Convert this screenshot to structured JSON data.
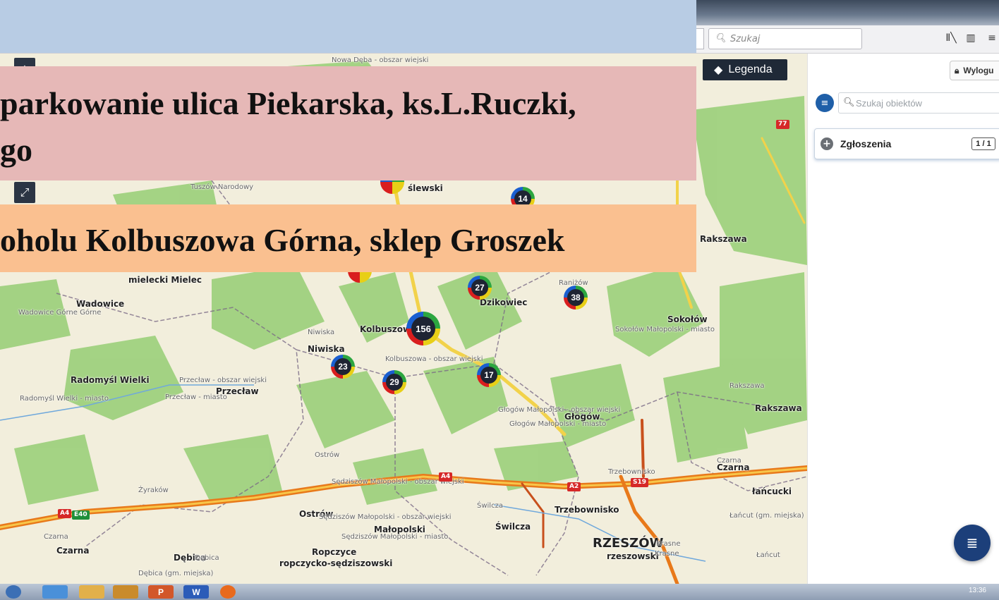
{
  "browser": {
    "search_placeholder": "Szukaj",
    "icons": [
      "library-icon",
      "sidebar-icon",
      "menu-icon"
    ]
  },
  "overlay": {
    "pink_line1": "parkowanie ulica Piekarska, ks.L.Ruczki,",
    "pink_line2": "go",
    "orange_line": "oholu Kolbuszowa Górna, sklep Groszek",
    "colors": {
      "blue": "#b8cce4",
      "pink": "#e6b8b7",
      "orange": "#fac090"
    }
  },
  "map": {
    "legend_label": "Legenda",
    "clusters": [
      {
        "label": "14"
      },
      {
        "label": "27"
      },
      {
        "label": "38"
      },
      {
        "label": "156"
      },
      {
        "label": "23"
      },
      {
        "label": "29"
      },
      {
        "label": "17"
      }
    ],
    "places": {
      "nowa_deba": "Nowa Dęba - obszar wiejski",
      "tuszow": "Tuszów Narodowy",
      "slewski": "ślewski",
      "mielecki": "mielecki Mielec",
      "wadowice": "Wadowice",
      "wadowice_gorne": "Wadowice Górne Górne",
      "dzikowiec": "Dzikowiec",
      "ranizow": "Raniżów",
      "niwiska1": "Niwiska",
      "niwiska2": "Niwiska",
      "kolbuszowa": "Kolbuszowa",
      "kolbuszowa_ow": "Kolbuszowa - obszar wiejski",
      "sokolow": "Sokołów",
      "sokolow_m": "Sokołów Małopolski - miasto",
      "radomysl": "Radomyśl Wielki",
      "radomysl_m": "Radomyśl Wielki - miasto",
      "przeclaw_ow": "Przecław - obszar wiejski",
      "przeclaw": "Przecław",
      "przeclaw_m": "Przecław - miasto",
      "glogow": "Głogów Małopolski - obszar wiejski",
      "glogow_b": "Głogów",
      "glogow_m": "Głogów Małopolski - miasto",
      "rakszawa1": "Rakszawa",
      "rakszawa2": "Rakszawa",
      "rakszawa3": "Rakszawa",
      "ostrow1": "Ostrów",
      "ostrow2": "Ostrów",
      "zyrakow": "Żyraków",
      "sedziszow": "Sędziszów Małopolski - obszar wiejski",
      "sedziszow2": "Sędziszów Małopolski - obszar wiejski",
      "sedziszow_m": "Sędziszów Małopolski - miasto",
      "malopolski": "Małopolski",
      "swilcza1": "Świlcza",
      "swilcza2": "Świlcza",
      "trzebownisko1": "Trzebownisko",
      "trzebownisko2": "Trzebownisko",
      "czarna1": "Czarna",
      "czarna2": "Czarna",
      "czarna3": "Czarna",
      "czarna4": "Czarna",
      "lancut1": "łańcucki",
      "lancut2": "Łańcut (gm. miejska)",
      "lancut3": "Łańcut",
      "rzeszow": "RZESZÓW",
      "rzeszowski": "rzeszowski",
      "krasne1": "Krasne",
      "krasne2": "Krasne",
      "debica1": "Dębica",
      "debica2": "Dębica",
      "debica_gm": "Dębica (gm. miejska)",
      "ropczyce": "Ropczyce",
      "ropczycko": "ropczycko-sędziszowski",
      "rakszawa_r": "Rakszawa"
    },
    "shields": {
      "a4_left": "A4",
      "e40": "E40",
      "a4_mid": "A4",
      "a2": "A2",
      "s19": "S19",
      "r77": "77"
    }
  },
  "panel": {
    "logout_label": "Wylogu",
    "object_search_placeholder": "Szukaj obiektów",
    "reports_label": "Zgłoszenia",
    "reports_count": "1 / 1"
  },
  "taskbar": {
    "clock": "13:36"
  }
}
